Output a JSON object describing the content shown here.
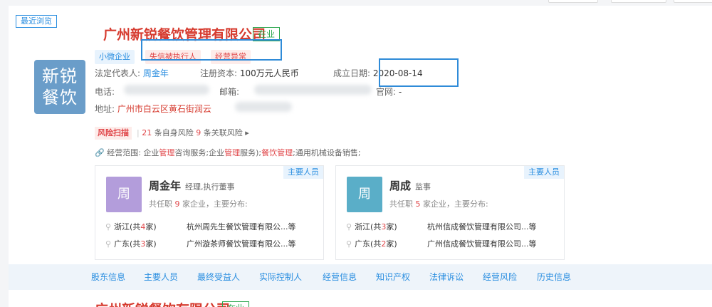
{
  "recent_tag": "最近浏览",
  "company": {
    "logo_line1": "新锐",
    "logo_line2": "餐饮",
    "name": "广州新锐餐饮管理有限公司",
    "status": "在业",
    "tags": [
      "小微企业",
      "失信被执行人",
      "经营异常"
    ],
    "legal_rep_label": "法定代表人:",
    "legal_rep": "周金年",
    "capital_label": "注册资本:",
    "capital": "100万元人民币",
    "founded_label": "成立日期:",
    "founded": "2020-08-14",
    "phone_label": "电话:",
    "email_label": "邮箱:",
    "website_label": "官网:",
    "website": "-",
    "address_label": "地址:",
    "address": "广州市白云区黄石街润云",
    "risk_label": "风险扫描",
    "risk_self_count": "21",
    "risk_self_text": "条自身风险",
    "risk_related_count": "9",
    "risk_related_text": "条关联风险",
    "scope_label": "经营范围:",
    "scope_p1": "企业",
    "scope_h1": "管理",
    "scope_p2": "咨询服务;企业",
    "scope_h2": "管理",
    "scope_p3": "服务);",
    "scope_h3": "餐饮管理",
    "scope_p4": ";通用机械设备销售;"
  },
  "people": [
    {
      "avatar": "周",
      "name": "周金年",
      "role": "经理,执行董事",
      "label": "主要人员",
      "count_prefix": "共任职",
      "count": "9",
      "count_suffix": "家企业，主要分布:",
      "loc1_prefix": "浙江(共",
      "loc1_count": "4",
      "loc1_suffix": "家)",
      "loc1_company": "杭州周先生餐饮管理有限公...等",
      "loc2_prefix": "广东(共",
      "loc2_count": "3",
      "loc2_suffix": "家)",
      "loc2_company": "广州漩茶师餐饮管理有限公...等",
      "color": "#b39ddb"
    },
    {
      "avatar": "周",
      "name": "周成",
      "role": "监事",
      "label": "主要人员",
      "count_prefix": "共任职",
      "count": "5",
      "count_suffix": "家企业，主要分布:",
      "loc1_prefix": "浙江(共",
      "loc1_count": "3",
      "loc1_suffix": "家)",
      "loc1_company": "杭州信成餐饮管理有限公司...等",
      "loc2_prefix": "广东(共",
      "loc2_count": "2",
      "loc2_suffix": "家)",
      "loc2_company": "广州信成餐饮管理有限公司...等",
      "color": "#5aaec8"
    }
  ],
  "nav": [
    "股东信息",
    "主要人员",
    "最终受益人",
    "实际控制人",
    "经营信息",
    "知识产权",
    "法律诉讼",
    "经营风险",
    "历史信息"
  ],
  "next_company": {
    "name": "广州新锐餐饮有限公司",
    "status": "在业"
  }
}
